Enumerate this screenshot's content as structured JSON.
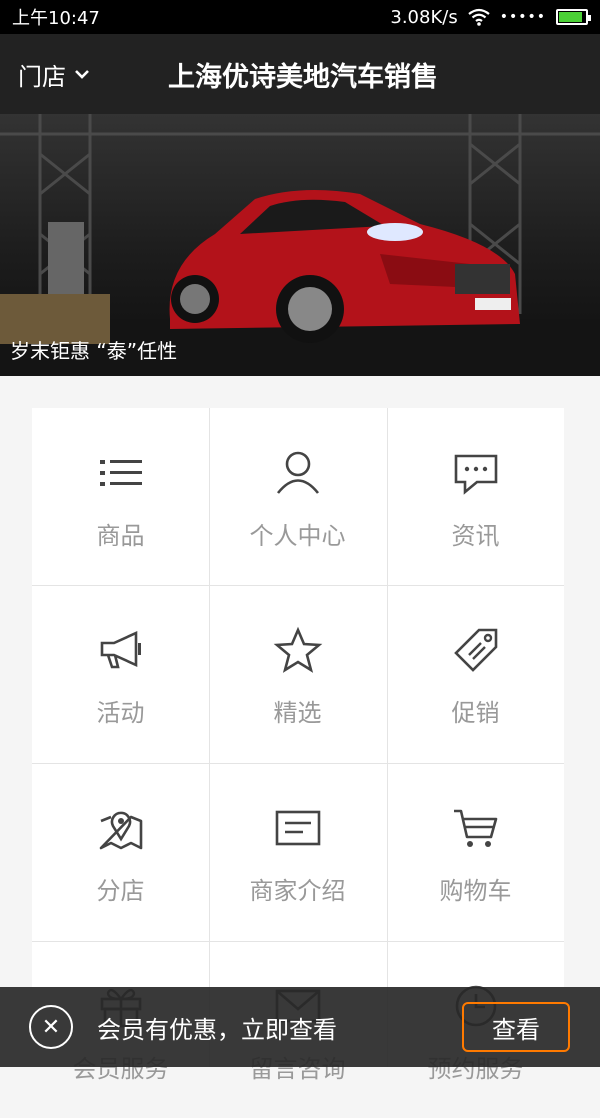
{
  "status_bar": {
    "time": "上午10:47",
    "speed": "3.08K/s",
    "signal": "•••••",
    "battery_level": 0.9
  },
  "header": {
    "store_label": "门店",
    "title": "上海优诗美地汽车销售"
  },
  "banner": {
    "caption": "岁末钜惠 “泰”任性"
  },
  "menu": [
    {
      "label": "商品",
      "icon": "list-icon"
    },
    {
      "label": "个人中心",
      "icon": "user-icon"
    },
    {
      "label": "资讯",
      "icon": "chat-icon"
    },
    {
      "label": "活动",
      "icon": "megaphone-icon"
    },
    {
      "label": "精选",
      "icon": "star-icon"
    },
    {
      "label": "促销",
      "icon": "tag-icon"
    },
    {
      "label": "分店",
      "icon": "map-pin-icon"
    },
    {
      "label": "商家介绍",
      "icon": "message-box-icon"
    },
    {
      "label": "购物车",
      "icon": "cart-icon"
    },
    {
      "label": "会员服务",
      "icon": "gift-icon"
    },
    {
      "label": "留言咨询",
      "icon": "mail-icon"
    },
    {
      "label": "预约服务",
      "icon": "clock-icon"
    }
  ],
  "promo": {
    "text": "会员有优惠，立即查看",
    "button_label": "查看"
  }
}
